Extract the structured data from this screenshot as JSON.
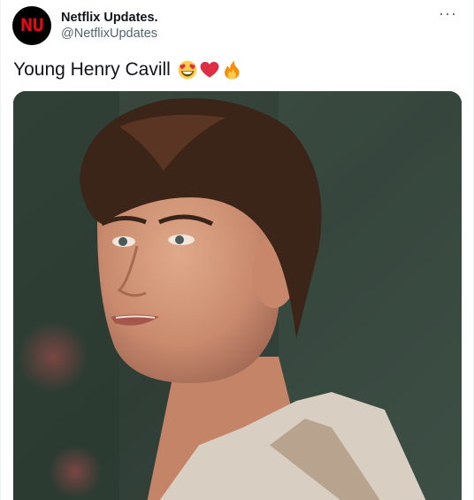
{
  "author": {
    "display_name": "Netflix Updates.",
    "handle": "@NetflixUpdates",
    "avatar_logo": "NU"
  },
  "more_menu": "···",
  "tweet": {
    "text": "Young Henry Cavill",
    "emojis": [
      "heart-eyes-emoji",
      "red-heart-emoji",
      "fire-emoji"
    ]
  },
  "media": {
    "subject": "photo-of-young-man"
  },
  "colors": {
    "brand_red": "#e50914",
    "text_primary": "#0f1419",
    "text_secondary": "#536471"
  }
}
